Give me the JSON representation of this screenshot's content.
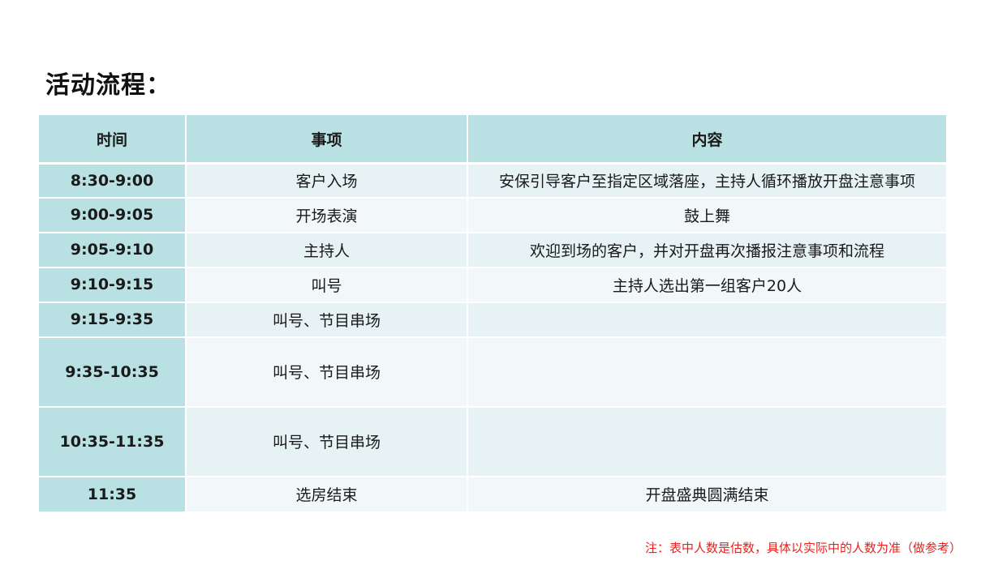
{
  "title": "活动流程：",
  "table": {
    "headers": [
      "时间",
      "事项",
      "内容"
    ],
    "rows": [
      {
        "time": "8:30-9:00",
        "item": "客户入场",
        "content": "安保引导客户至指定区域落座，主持人循环播放开盘注意事项"
      },
      {
        "time": "9:00-9:05",
        "item": "开场表演",
        "content": "鼓上舞"
      },
      {
        "time": "9:05-9:10",
        "item": "主持人",
        "content": "欢迎到场的客户，并对开盘再次播报注意事项和流程"
      },
      {
        "time": "9:10-9:15",
        "item": "叫号",
        "content": "主持人选出第一组客户20人"
      },
      {
        "time": "9:15-9:35",
        "item": "叫号、节目串场",
        "content": ""
      },
      {
        "time": "9:35-10:35",
        "item": "叫号、节目串场",
        "content": ""
      },
      {
        "time": "10:35-11:35",
        "item": "叫号、节目串场",
        "content": ""
      },
      {
        "time": "11:35",
        "item": "选房结束",
        "content": "开盘盛典圆满结束"
      }
    ]
  },
  "footnote": "注：表中人数是估数，具体以实际中的人数为准（做参考）"
}
